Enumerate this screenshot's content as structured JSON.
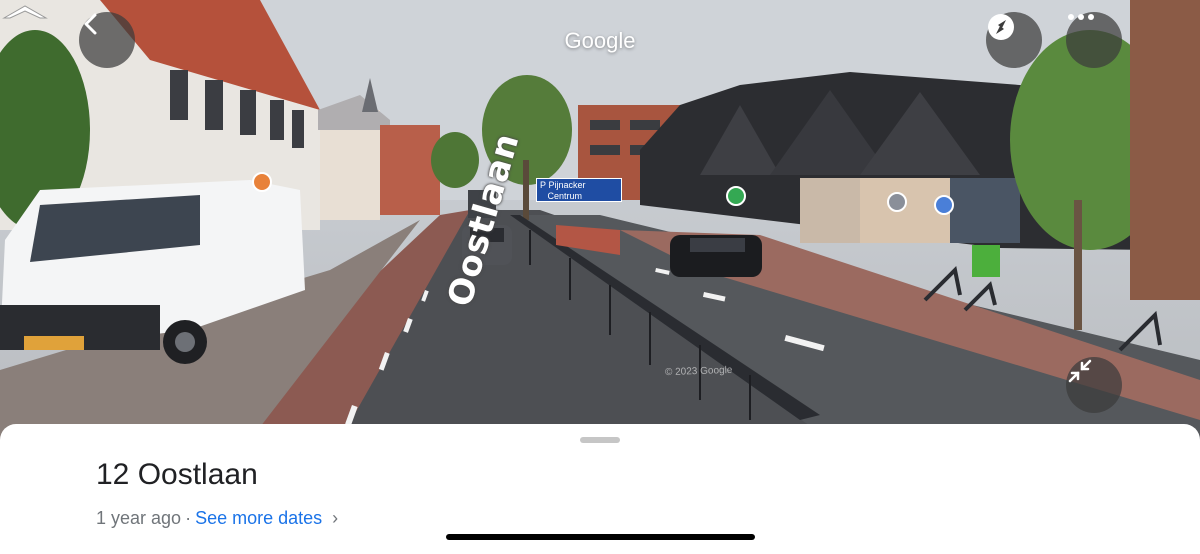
{
  "header": {
    "title": "Google",
    "back_icon": "chevron-left-icon",
    "compass_icon": "compass-icon",
    "more_icon": "more-horizontal-icon"
  },
  "panorama": {
    "street_label": "Oostlaan",
    "sign_text": "P  Pijnacker\n   Centrum",
    "watermark": "© 2023 Google",
    "collapse_icon": "collapse-icon",
    "navigation_arrow_icon": "navigation-arrow-icon"
  },
  "sheet": {
    "title": "12 Oostlaan",
    "date_text": "1 year ago",
    "separator": "·",
    "more_dates_link": "See more dates",
    "chevron": "›"
  },
  "colors": {
    "link": "#1a73e8",
    "title": "#202124",
    "secondary": "#70757a"
  }
}
